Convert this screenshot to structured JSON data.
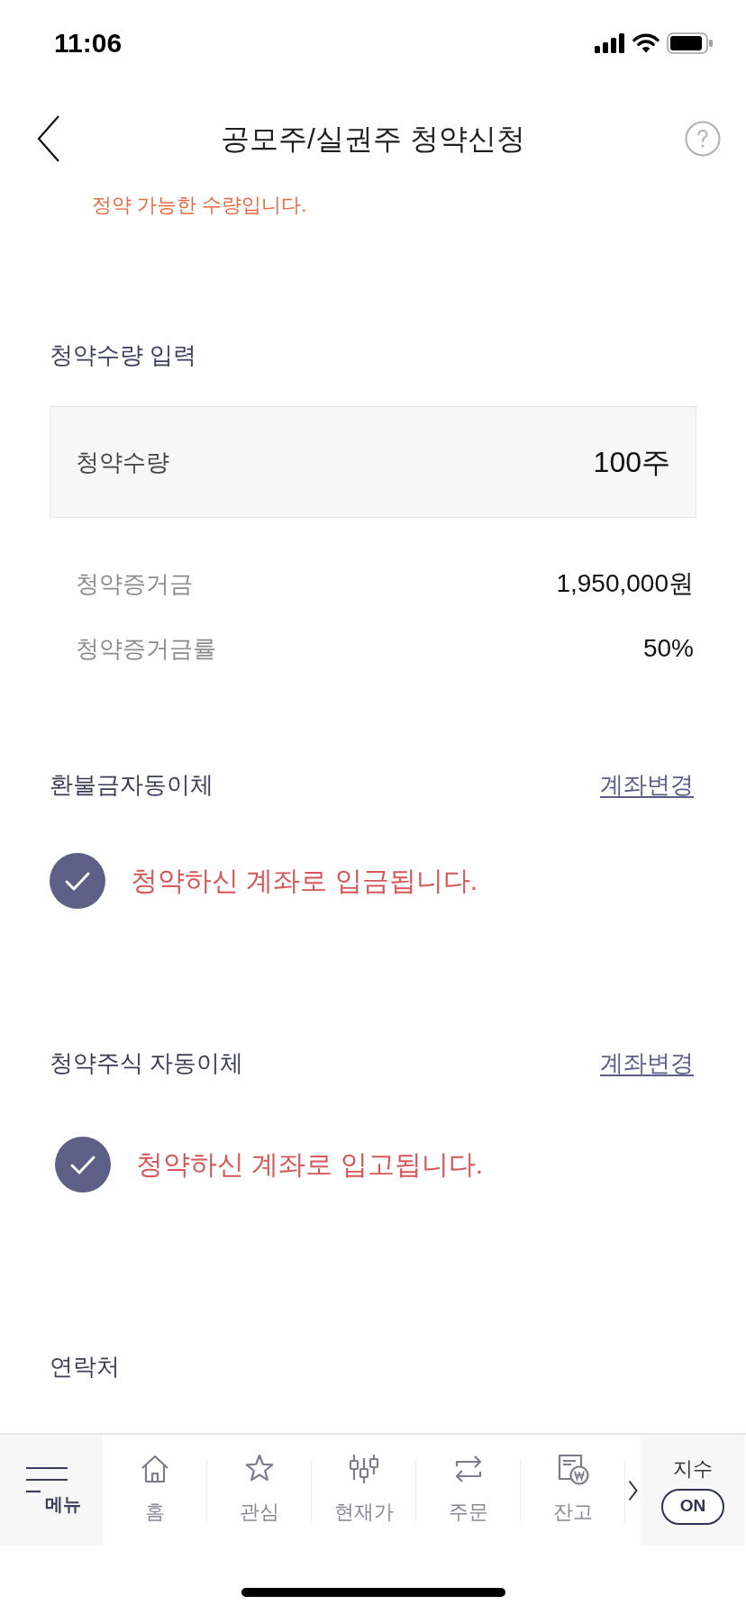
{
  "status_bar": {
    "time": "11:06"
  },
  "header": {
    "title": "공모주/실권주 청약신청"
  },
  "notice": "정약 가능한 수량입니다.",
  "quantity_section": {
    "heading": "청약수량 입력",
    "field": {
      "label": "청약수량",
      "value": "100주"
    },
    "rows": [
      {
        "label": "청약증거금",
        "value": "1,950,000원"
      },
      {
        "label": "청약증거금률",
        "value": "50%"
      }
    ]
  },
  "transfer_sections": [
    {
      "heading": "환불금자동이체",
      "link": "계좌변경",
      "option": {
        "text": "청약하신 계좌로 입금됩니다.",
        "checked": true
      }
    },
    {
      "heading": "청약주식 자동이체",
      "link": "계좌변경",
      "option": {
        "text": "청약하신 계좌로 입고됩니다.",
        "checked": true
      }
    }
  ],
  "contact_section": {
    "heading": "연락처"
  },
  "bottom_nav": {
    "menu_label": "메뉴",
    "items": [
      {
        "label": "홈",
        "kind": "home"
      },
      {
        "label": "관심",
        "kind": "star"
      },
      {
        "label": "현재가",
        "kind": "candles"
      },
      {
        "label": "주문",
        "kind": "exchange"
      },
      {
        "label": "잔고",
        "kind": "balance"
      }
    ],
    "index_toggle": {
      "label": "지수",
      "value": "ON"
    }
  }
}
